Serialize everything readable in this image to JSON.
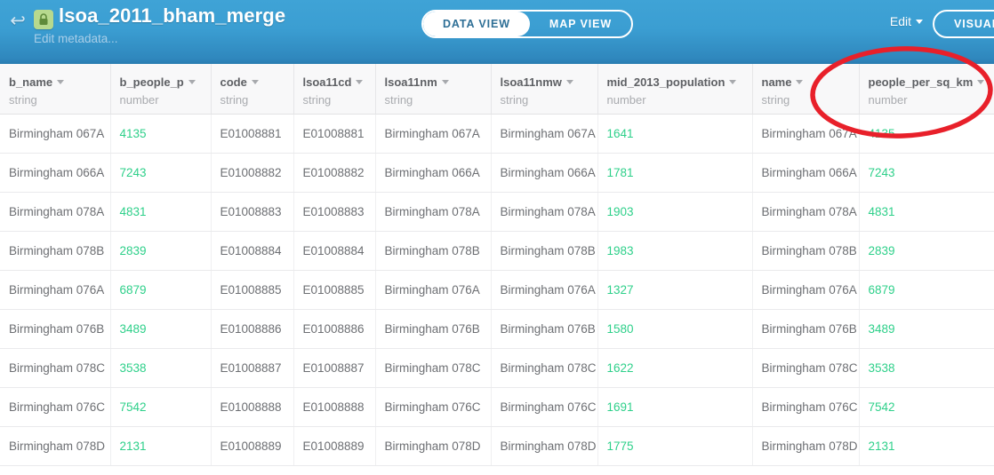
{
  "header": {
    "back_icon": "back-arrow-icon",
    "lock_icon": "lock-icon",
    "title": "lsoa_2011_bham_merge",
    "subtitle": "Edit metadata...",
    "edit_label": "Edit",
    "visualize_label": "VISUALIZE",
    "view_toggle": {
      "data_view": "DATA VIEW",
      "map_view": "MAP VIEW",
      "active": "DATA VIEW"
    },
    "colors": {
      "header_top": "#3fa3d6",
      "header_bottom": "#2a7cb0",
      "lock_badge": "#b7d98e",
      "number_green": "#2ed08a",
      "annotation_red": "#e8202a"
    }
  },
  "table": {
    "columns": [
      {
        "name": "b_name",
        "type": "string"
      },
      {
        "name": "b_people_p",
        "type": "number"
      },
      {
        "name": "code",
        "type": "string"
      },
      {
        "name": "lsoa11cd",
        "type": "string"
      },
      {
        "name": "lsoa11nm",
        "type": "string"
      },
      {
        "name": "lsoa11nmw",
        "type": "string"
      },
      {
        "name": "mid_2013_population",
        "type": "number"
      },
      {
        "name": "name",
        "type": "string"
      },
      {
        "name": "people_per_sq_km",
        "type": "number"
      }
    ],
    "rows": [
      [
        "Birmingham 067A",
        "4135",
        "E01008881",
        "E01008881",
        "Birmingham 067A",
        "Birmingham 067A",
        "1641",
        "Birmingham 067A",
        "4135"
      ],
      [
        "Birmingham 066A",
        "7243",
        "E01008882",
        "E01008882",
        "Birmingham 066A",
        "Birmingham 066A",
        "1781",
        "Birmingham 066A",
        "7243"
      ],
      [
        "Birmingham 078A",
        "4831",
        "E01008883",
        "E01008883",
        "Birmingham 078A",
        "Birmingham 078A",
        "1903",
        "Birmingham 078A",
        "4831"
      ],
      [
        "Birmingham 078B",
        "2839",
        "E01008884",
        "E01008884",
        "Birmingham 078B",
        "Birmingham 078B",
        "1983",
        "Birmingham 078B",
        "2839"
      ],
      [
        "Birmingham 076A",
        "6879",
        "E01008885",
        "E01008885",
        "Birmingham 076A",
        "Birmingham 076A",
        "1327",
        "Birmingham 076A",
        "6879"
      ],
      [
        "Birmingham 076B",
        "3489",
        "E01008886",
        "E01008886",
        "Birmingham 076B",
        "Birmingham 076B",
        "1580",
        "Birmingham 076B",
        "3489"
      ],
      [
        "Birmingham 078C",
        "3538",
        "E01008887",
        "E01008887",
        "Birmingham 078C",
        "Birmingham 078C",
        "1622",
        "Birmingham 078C",
        "3538"
      ],
      [
        "Birmingham 076C",
        "7542",
        "E01008888",
        "E01008888",
        "Birmingham 076C",
        "Birmingham 076C",
        "1691",
        "Birmingham 076C",
        "7542"
      ],
      [
        "Birmingham 078D",
        "2131",
        "E01008889",
        "E01008889",
        "Birmingham 078D",
        "Birmingham 078D",
        "1775",
        "Birmingham 078D",
        "2131"
      ]
    ]
  },
  "annotation": {
    "shape": "ellipse",
    "target_column": "people_per_sq_km",
    "color": "#e8202a"
  }
}
